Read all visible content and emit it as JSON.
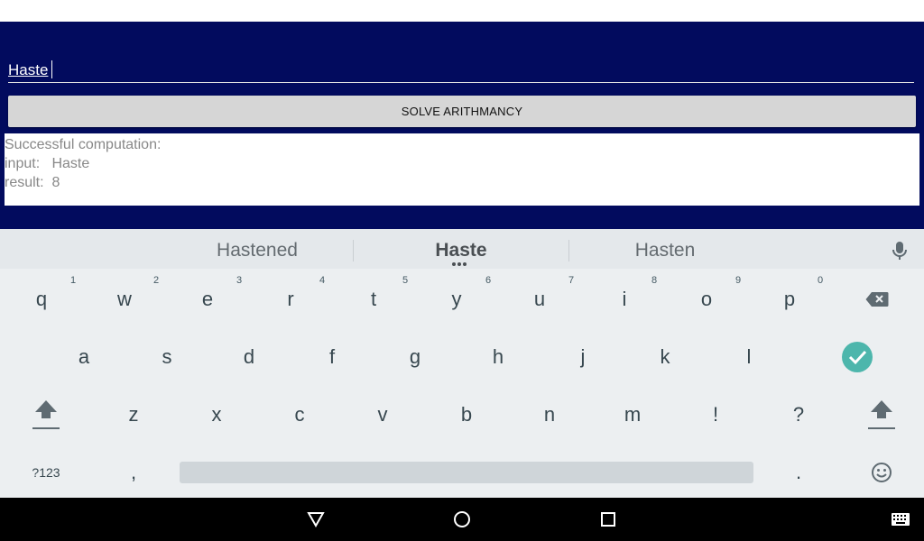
{
  "app": {
    "input_value": "Haste",
    "solve_label": "SOLVE ARITHMANCY",
    "result": {
      "line1": "Successful computation:",
      "line2": "input:   Haste",
      "line3": "result:  8"
    }
  },
  "keyboard": {
    "suggestions": [
      "Hastened",
      "Haste",
      "Hasten"
    ],
    "row1": [
      "q",
      "w",
      "e",
      "r",
      "t",
      "y",
      "u",
      "i",
      "o",
      "p"
    ],
    "row1_hints": [
      "1",
      "2",
      "3",
      "4",
      "5",
      "6",
      "7",
      "8",
      "9",
      "0"
    ],
    "row2": [
      "a",
      "s",
      "d",
      "f",
      "g",
      "h",
      "j",
      "k",
      "l"
    ],
    "row3": [
      "z",
      "x",
      "c",
      "v",
      "b",
      "n",
      "m",
      "!",
      "?"
    ],
    "symbols_label": "?123",
    "comma": ",",
    "period": ".",
    "colors": {
      "enter": "#4db6ac",
      "icon": "#5f6b72"
    }
  }
}
